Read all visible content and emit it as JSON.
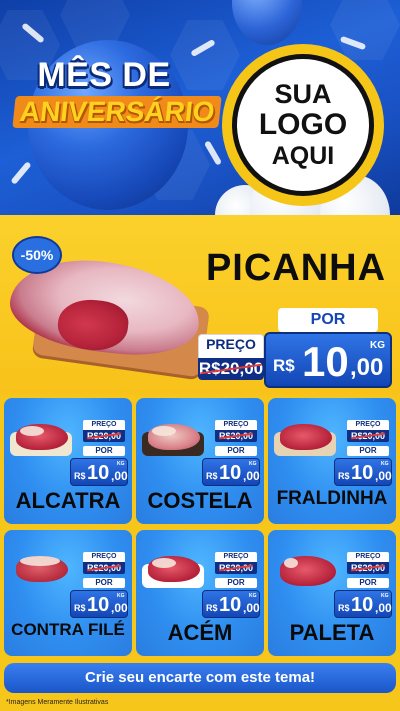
{
  "header": {
    "title_line1": "MÊS DE",
    "title_line2": "ANIVERSÁRIO",
    "logo": {
      "line1": "SUA",
      "line2": "LOGO",
      "line3": "AQUI"
    }
  },
  "featured": {
    "discount": "-50%",
    "name": "PICANHA",
    "preco_label": "PREÇO",
    "old_price": "R$20,00",
    "por_label": "POR",
    "currency": "R$",
    "price_int": "10",
    "price_dec": ",00",
    "unit": "KG"
  },
  "products": [
    {
      "name": "ALCATRA",
      "preco_label": "PREÇO",
      "old_price": "R$20,00",
      "por_label": "POR",
      "currency": "R$",
      "price_int": "10",
      "price_dec": ",00",
      "unit": "KG"
    },
    {
      "name": "COSTELA",
      "preco_label": "PREÇO",
      "old_price": "R$20,00",
      "por_label": "POR",
      "currency": "R$",
      "price_int": "10",
      "price_dec": ",00",
      "unit": "KG"
    },
    {
      "name": "FRALDINHA",
      "preco_label": "PREÇO",
      "old_price": "R$20,00",
      "por_label": "POR",
      "currency": "R$",
      "price_int": "10",
      "price_dec": ",00",
      "unit": "KG"
    },
    {
      "name": "CONTRA FILÉ",
      "preco_label": "PREÇO",
      "old_price": "R$20,00",
      "por_label": "POR",
      "currency": "R$",
      "price_int": "10",
      "price_dec": ",00",
      "unit": "KG"
    },
    {
      "name": "ACÉM",
      "preco_label": "PREÇO",
      "old_price": "R$20,00",
      "por_label": "POR",
      "currency": "R$",
      "price_int": "10",
      "price_dec": ",00",
      "unit": "KG"
    },
    {
      "name": "PALETA",
      "preco_label": "PREÇO",
      "old_price": "R$20,00",
      "por_label": "POR",
      "currency": "R$",
      "price_int": "10",
      "price_dec": ",00",
      "unit": "KG"
    }
  ],
  "cta": "Crie seu encarte com este tema!",
  "disclaimer": "*Imagens Meramente Ilustrativas",
  "colors": {
    "brand_blue": "#1a56c8",
    "accent_yellow": "#f7c61a",
    "price_blue": "#1346b5",
    "dark_blue": "#0f2f86",
    "strike_red": "#e23b3b"
  }
}
